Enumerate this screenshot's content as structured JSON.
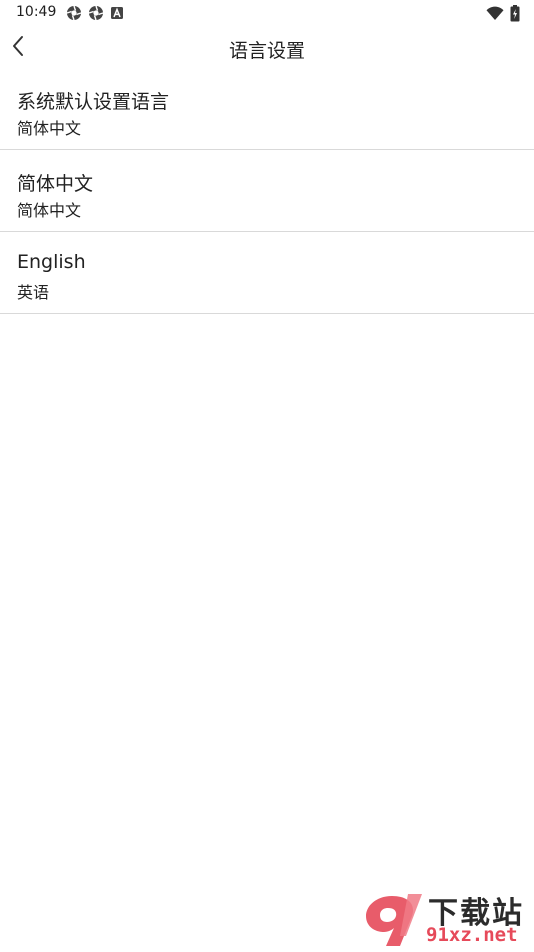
{
  "status_bar": {
    "time": "10:49",
    "left_icons": [
      "aperture-icon",
      "aperture-icon",
      "a-box-icon"
    ],
    "right_icons": [
      "wifi-icon",
      "battery-icon"
    ]
  },
  "app_bar": {
    "back_icon": "chevron-left-icon",
    "title": "语言设置"
  },
  "languages": [
    {
      "title": "系统默认设置语言",
      "subtitle": "简体中文"
    },
    {
      "title": "简体中文",
      "subtitle": "简体中文"
    },
    {
      "title": "English",
      "subtitle": "英语"
    }
  ],
  "watermark": {
    "logo_text": "9",
    "brand": "下载站",
    "url": "91xz.net",
    "accent_color": "#e64a5a"
  },
  "colors": {
    "background": "#ffffff",
    "divider": "#d9d9d9",
    "text": "#222222"
  }
}
